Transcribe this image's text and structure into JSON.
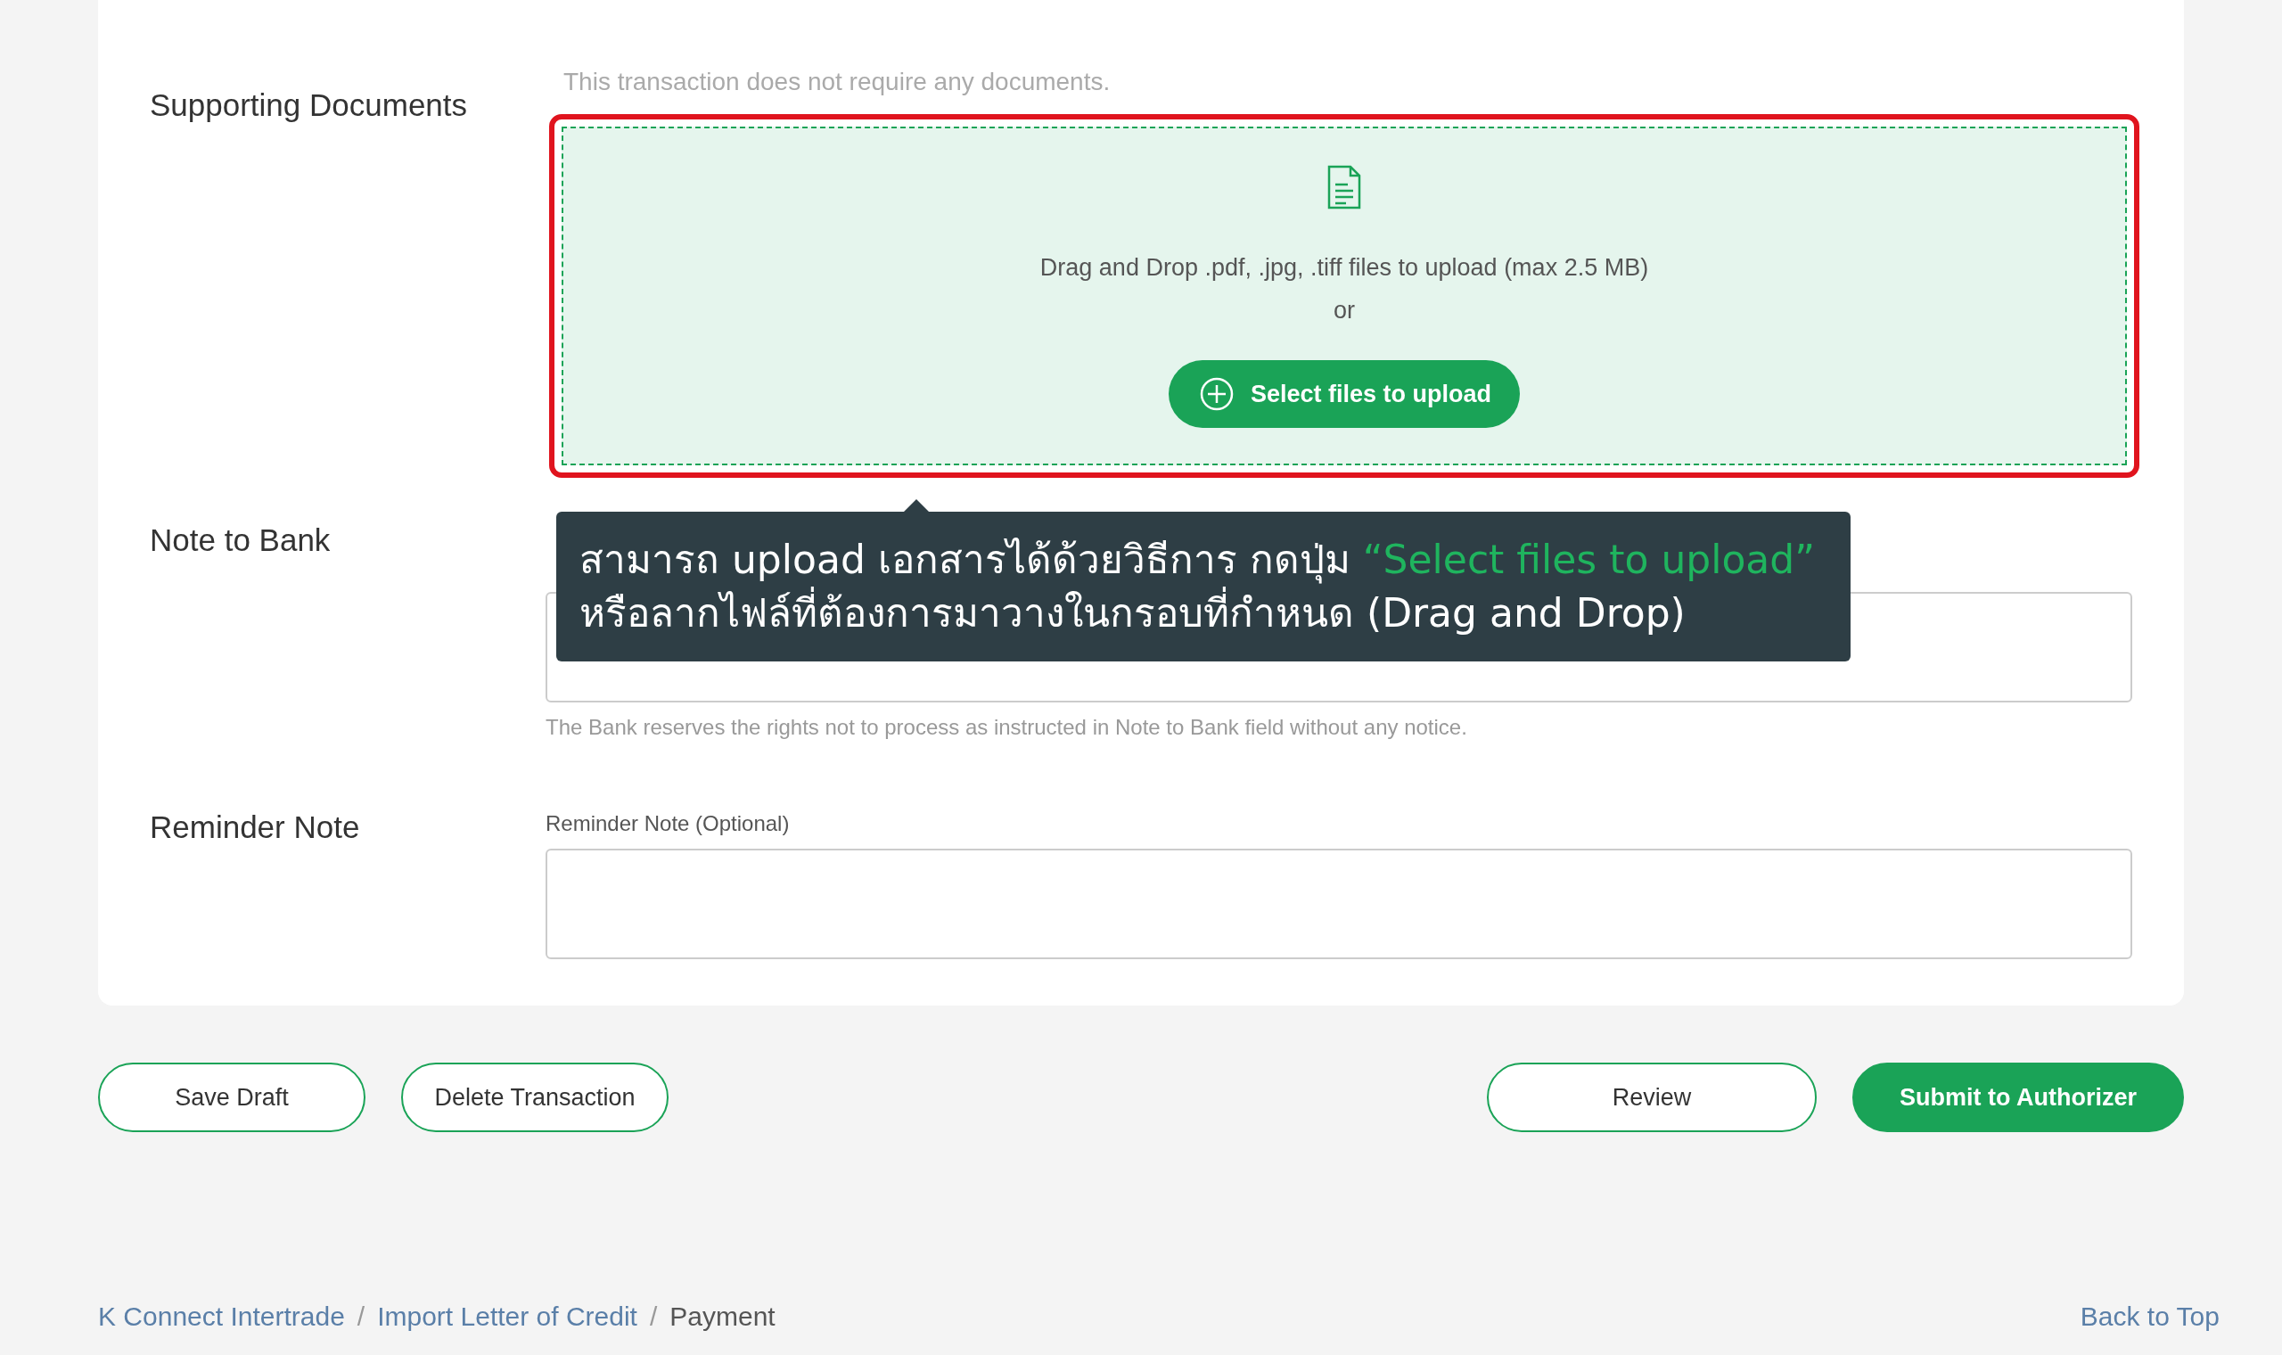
{
  "supporting_documents": {
    "label": "Supporting Documents",
    "note": "This transaction does not require any documents.",
    "dropzone_text": "Drag and Drop .pdf, .jpg, .tiff files to upload (max 2.5 MB)",
    "or": "or",
    "button": "Select files to upload",
    "highlighted": true
  },
  "tooltip": {
    "text": "สามารถ upload เอกสารได้ด้วยวิธีการ กดปุ่ม",
    "highlight": "“Select files to upload”",
    "line2": "หรือลากไฟล์ที่ต้องการมาวางในกรอบที่กำหนด (Drag and Drop)"
  },
  "note_to_bank": {
    "label": "Note to Bank",
    "hint": "The Bank reserves the rights not to process as instructed in Note to Bank field without any notice."
  },
  "reminder_note": {
    "label": "Reminder Note",
    "field_label": "Reminder Note (Optional)"
  },
  "left_buttons": [
    {
      "label": "Save Draft",
      "kind": "outline"
    },
    {
      "label": "Delete Transaction",
      "kind": "outline"
    }
  ],
  "right_buttons": [
    {
      "label": "Review",
      "kind": "outline"
    },
    {
      "label": "Submit to Authorizer",
      "kind": "primary"
    }
  ],
  "breadcrumb": [
    {
      "label": "K Connect Intertrade",
      "link": true
    },
    {
      "separator": "/",
      "label": "Import Letter of Credit",
      "link": true
    },
    {
      "separator": "/",
      "label": "Payment",
      "link": false
    }
  ],
  "back_to_top": "Back to Top"
}
